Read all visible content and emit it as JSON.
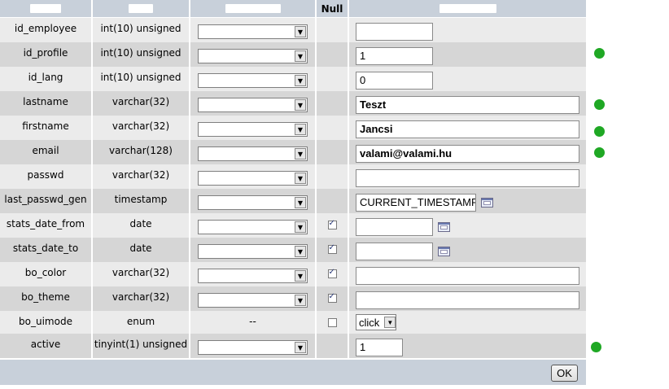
{
  "header": {
    "null_label": "Null"
  },
  "rows": [
    {
      "name": "id_employee",
      "type": "int(10) unsigned",
      "null_checkbox": false,
      "null_checked": false,
      "value": "",
      "input_size": "short",
      "calendar": false,
      "required": false
    },
    {
      "name": "id_profile",
      "type": "int(10) unsigned",
      "null_checkbox": false,
      "null_checked": false,
      "value": "1",
      "input_size": "short",
      "calendar": false,
      "required": true
    },
    {
      "name": "id_lang",
      "type": "int(10) unsigned",
      "null_checkbox": false,
      "null_checked": false,
      "value": "0",
      "input_size": "short",
      "calendar": false,
      "required": false
    },
    {
      "name": "lastname",
      "type": "varchar(32)",
      "null_checkbox": false,
      "null_checked": false,
      "value": " Teszt",
      "input_size": "long",
      "calendar": false,
      "required": true
    },
    {
      "name": "firstname",
      "type": "varchar(32)",
      "null_checkbox": false,
      "null_checked": false,
      "value": "Jancsi",
      "input_size": "long",
      "calendar": false,
      "required": true
    },
    {
      "name": "email",
      "type": "varchar(128)",
      "null_checkbox": false,
      "null_checked": false,
      "value": "valami@valami.hu",
      "input_size": "long",
      "calendar": false,
      "required": true
    },
    {
      "name": "passwd",
      "type": "varchar(32)",
      "null_checkbox": false,
      "null_checked": false,
      "value": "",
      "input_size": "long",
      "calendar": false,
      "required": false
    },
    {
      "name": "last_passwd_gen",
      "type": "timestamp",
      "null_checkbox": false,
      "null_checked": false,
      "value": "CURRENT_TIMESTAMP",
      "input_size": "medium",
      "calendar": true,
      "required": false
    },
    {
      "name": "stats_date_from",
      "type": "date",
      "null_checkbox": true,
      "null_checked": true,
      "value": "",
      "input_size": "short",
      "calendar": true,
      "required": false
    },
    {
      "name": "stats_date_to",
      "type": "date",
      "null_checkbox": true,
      "null_checked": true,
      "value": "",
      "input_size": "short",
      "calendar": true,
      "required": false
    },
    {
      "name": "bo_color",
      "type": "varchar(32)",
      "null_checkbox": true,
      "null_checked": true,
      "value": "",
      "input_size": "long",
      "calendar": false,
      "required": false
    },
    {
      "name": "bo_theme",
      "type": "varchar(32)",
      "null_checkbox": true,
      "null_checked": true,
      "value": "",
      "input_size": "long",
      "calendar": false,
      "required": false
    },
    {
      "name": "bo_uimode",
      "type": "enum",
      "function_text": "--",
      "null_checkbox": true,
      "null_checked": false,
      "value": "click",
      "input_size": "select",
      "calendar": false,
      "required": false
    },
    {
      "name": "active",
      "type": "tinyint(1) unsigned",
      "null_checkbox": false,
      "null_checked": false,
      "value": "1",
      "input_size": "tiny",
      "calendar": false,
      "required": true
    }
  ],
  "footer": {
    "ok_label": "OK"
  },
  "colors": {
    "header_bg": "#c8d0da",
    "row_even": "#ebebeb",
    "row_odd": "#d6d6d6",
    "required_dot": "#1fa824"
  }
}
